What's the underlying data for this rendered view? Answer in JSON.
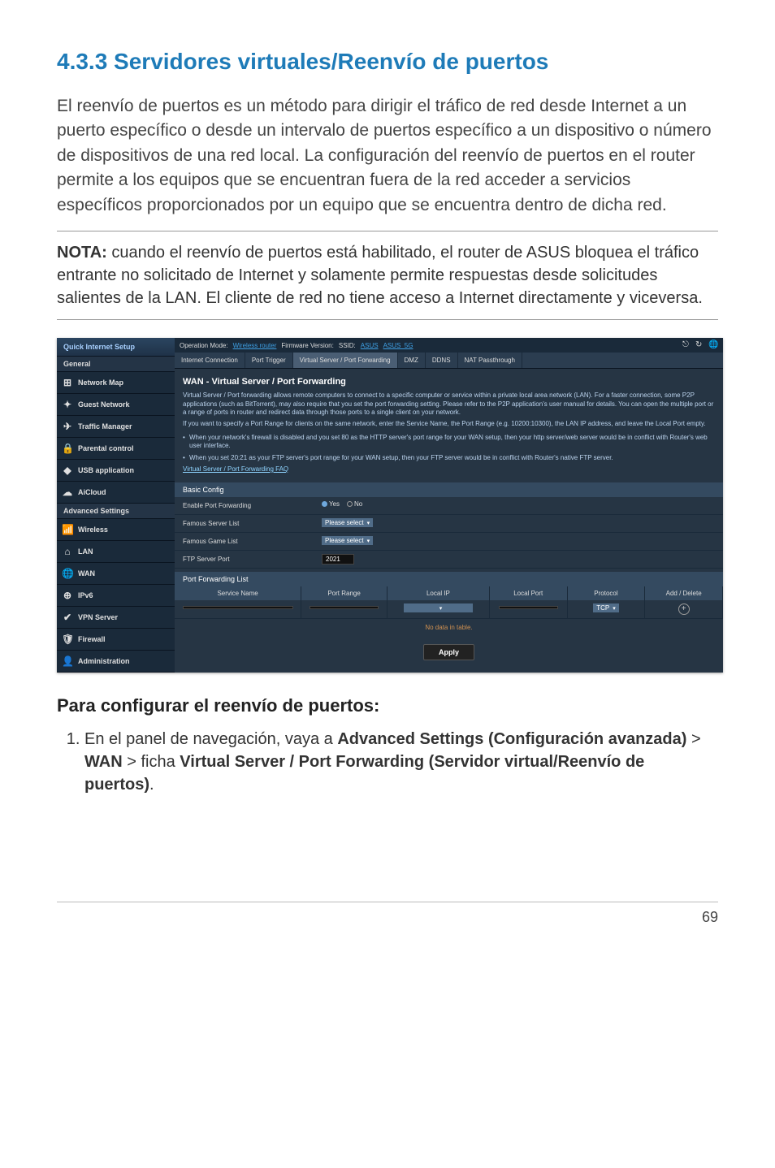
{
  "page": {
    "number": "69",
    "heading": "4.3.3 Servidores virtuales/Reenvío de puertos",
    "intro": "El reenvío de puertos es un método para dirigir el tráfico de red desde Internet a un puerto específico o desde un intervalo de puertos específico a un dispositivo o número de dispositivos de una red local. La configuración del reenvío de puertos en el router permite a los equipos que se encuentran fuera de la red acceder a servicios específicos proporcionados por un equipo que se encuentra dentro de dicha red.",
    "note_label": "NOTA:",
    "note_text": "  cuando el reenvío de puertos está habilitado, el router de ASUS bloquea el tráfico entrante no solicitado de Internet y solamente permite respuestas desde solicitudes salientes de la LAN. El cliente de red no tiene acceso a Internet directamente y viceversa.",
    "subheading": "Para configurar el reenvío de puertos:",
    "step1_prefix": "En el panel de navegación, vaya a ",
    "step1_bold1": "Advanced Settings (Configuración avanzada)",
    "step1_gt1": " > ",
    "step1_bold2": "WAN",
    "step1_gt2": " > ficha ",
    "step1_bold3": "Virtual Server / Port Forwarding (Servidor virtual/Reenvío de puertos)",
    "step1_suffix": "."
  },
  "ui": {
    "sidebar": {
      "qis": "Quick Internet Setup",
      "general_header": "General",
      "items_general": [
        {
          "label": "Network Map",
          "icon": "⊞"
        },
        {
          "label": "Guest Network",
          "icon": "✦"
        },
        {
          "label": "Traffic Manager",
          "icon": "✈"
        },
        {
          "label": "Parental control",
          "icon": "🔒"
        },
        {
          "label": "USB application",
          "icon": "◆"
        },
        {
          "label": "AiCloud",
          "icon": "☁"
        }
      ],
      "advanced_header": "Advanced Settings",
      "items_adv": [
        {
          "label": "Wireless",
          "icon": "📶"
        },
        {
          "label": "LAN",
          "icon": "⌂"
        },
        {
          "label": "WAN",
          "icon": "🌐"
        },
        {
          "label": "IPv6",
          "icon": "⊕"
        },
        {
          "label": "VPN Server",
          "icon": "✔"
        },
        {
          "label": "Firewall",
          "icon": "🛡"
        },
        {
          "label": "Administration",
          "icon": "👤"
        }
      ]
    },
    "topbar": {
      "op_mode_label": "Operation Mode:",
      "op_mode_value": "Wireless router",
      "fw_label": "Firmware Version:",
      "ssid_label": "SSID:",
      "ssid_1": "ASUS",
      "ssid_2": "ASUS_5G"
    },
    "tabs": [
      "Internet Connection",
      "Port Trigger",
      "Virtual Server / Port Forwarding",
      "DMZ",
      "DDNS",
      "NAT Passthrough"
    ],
    "active_tab_index": 2,
    "panel": {
      "title": "WAN - Virtual Server / Port Forwarding",
      "desc1": "Virtual Server / Port forwarding allows remote computers to connect to a specific computer or service within a private local area network (LAN). For a faster connection, some P2P applications (such as BitTorrent), may also require that you set the port forwarding setting. Please refer to the P2P application's user manual for details. You can open the multiple port or a range of ports in router and redirect data through those ports to a single client on your network.",
      "desc2": "If you want to specify a Port Range for clients on the same network, enter the Service Name, the Port Range (e.g. 10200:10300), the LAN IP address, and leave the Local Port empty.",
      "bullet1": "When your network's firewall is disabled and you set 80 as the HTTP server's port range for your WAN setup, then your http server/web server would be in conflict with Router's web user interface.",
      "bullet2": "When you set 20:21 as your FTP server's port range for your WAN setup, then your FTP server would be in conflict with Router's native FTP server.",
      "faq_link": "Virtual Server / Port Forwarding FAQ"
    },
    "basic": {
      "header": "Basic Config",
      "enable_label": "Enable Port Forwarding",
      "yes": "Yes",
      "no": "No",
      "famous_server_label": "Famous Server List",
      "famous_game_label": "Famous Game List",
      "please_select": "Please select",
      "ftp_port_label": "FTP Server Port",
      "ftp_port_value": "2021"
    },
    "pf": {
      "header": "Port Forwarding List",
      "cols": [
        "Service Name",
        "Port Range",
        "Local IP",
        "Local Port",
        "Protocol",
        "Add / Delete"
      ],
      "protocol_default": "TCP",
      "no_data": "No data in table."
    },
    "apply": "Apply"
  }
}
